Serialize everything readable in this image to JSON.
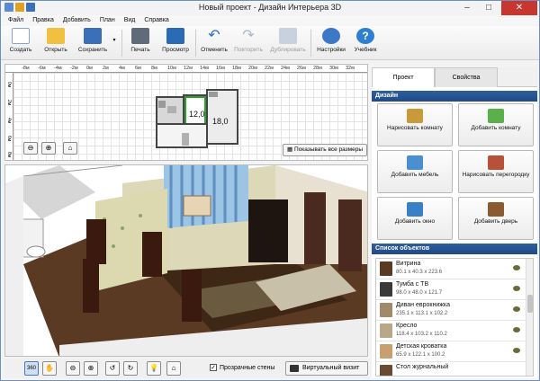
{
  "window": {
    "title": "Новый проект - Дизайн Интерьера 3D"
  },
  "menu": [
    "Файл",
    "Правка",
    "Добавить",
    "План",
    "Вид",
    "Справка"
  ],
  "toolbar": {
    "new": "Создать",
    "open": "Открыть",
    "save": "Сохранить",
    "print": "Печать",
    "preview": "Просмотр",
    "undo": "Отменить",
    "redo": "Повторить",
    "duplicate": "Дублировать",
    "settings": "Настройки",
    "tutorial": "Учебник"
  },
  "plan": {
    "ruler_labels": [
      "-8м",
      "-6м",
      "-4м",
      "-2м",
      "0м",
      "2м",
      "4м",
      "6м",
      "8м",
      "10м",
      "12м",
      "14м",
      "16м",
      "18м",
      "20м",
      "22м",
      "24м",
      "26м",
      "28м",
      "30м",
      "32м"
    ],
    "room_labels": [
      "12,0",
      "18,0"
    ],
    "show_dims": "Показывать все размеры"
  },
  "bottom": {
    "transparent_walls": "Прозрачные стены",
    "virtual_visit": "Виртуальный визит",
    "transparent_walls_checked": true
  },
  "panel": {
    "tabs": [
      "Проект",
      "Свойства"
    ],
    "design_header": "Дизайн",
    "design_buttons": [
      {
        "label": "Нарисовать комнату",
        "icon": "brush-icon"
      },
      {
        "label": "Добавить комнату",
        "icon": "add-room-icon"
      },
      {
        "label": "Добавить мебель",
        "icon": "armchair-icon"
      },
      {
        "label": "Нарисовать перегородку",
        "icon": "brick-wall-icon"
      },
      {
        "label": "Добавить окно",
        "icon": "window-icon"
      },
      {
        "label": "Добавить дверь",
        "icon": "door-icon"
      }
    ],
    "objects_header": "Список объектов",
    "objects": [
      {
        "name": "Витрина",
        "dims": "80.1 x 40.3 x 223.6"
      },
      {
        "name": "Тумба с ТВ",
        "dims": "98.0 x 48.0 x 121.7"
      },
      {
        "name": "Диван еврокнижка",
        "dims": "235.1 x 113.1 x 102.2"
      },
      {
        "name": "Кресло",
        "dims": "118.4 x 103.2 x 110.2"
      },
      {
        "name": "Детская кроватка",
        "dims": "65.9 x 122.1 x 100.2"
      },
      {
        "name": "Стол журнальный",
        "dims": ""
      }
    ]
  }
}
